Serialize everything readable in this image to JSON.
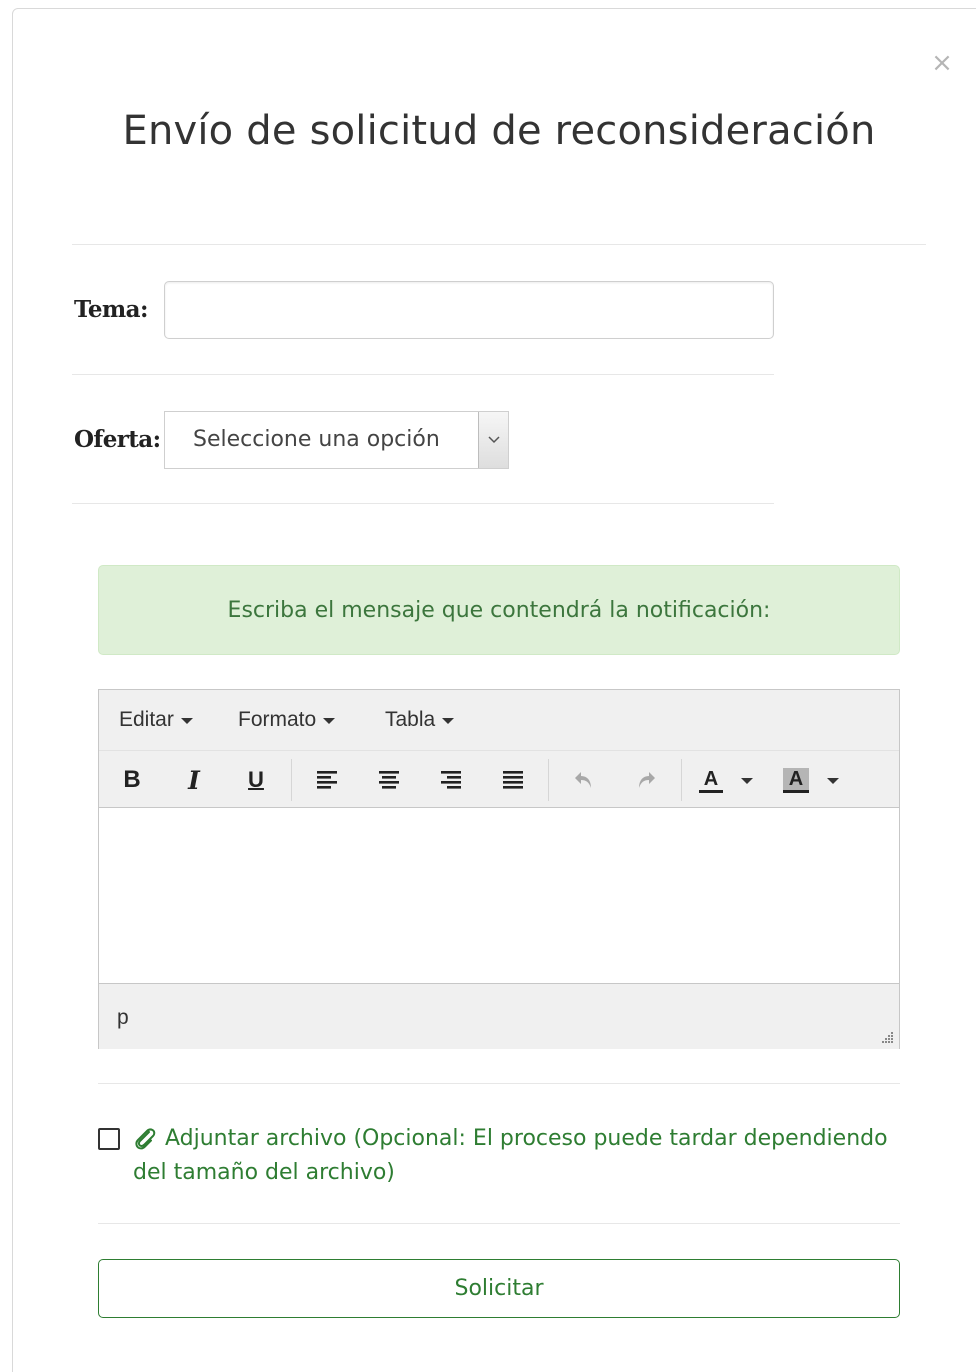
{
  "modal": {
    "title": "Envío de solicitud de reconsideración",
    "close": "×"
  },
  "form": {
    "tema_label": "Tema:",
    "tema_value": "",
    "oferta_label": "Oferta:",
    "oferta_selected": "Seleccione una opción"
  },
  "alert": {
    "message": "Escriba el mensaje que contendrá la notificación:"
  },
  "editor": {
    "menus": [
      "Editar",
      "Formato",
      "Tabla"
    ],
    "toolbar_icons": [
      "bold-icon",
      "italic-icon",
      "underline-icon",
      "align-left-icon",
      "align-center-icon",
      "align-right-icon",
      "align-justify-icon",
      "undo-icon",
      "redo-icon",
      "text-color-icon",
      "background-color-icon"
    ],
    "content": "",
    "status_path": "p"
  },
  "attachment": {
    "checked": false,
    "label": "Adjuntar archivo (Opcional: El proceso puede tardar dependiendo del tamaño del archivo)"
  },
  "submit": {
    "label": "Solicitar"
  },
  "colors": {
    "primary_green": "#2e7d32",
    "alert_bg": "#dff0d8",
    "alert_text": "#3c763d"
  }
}
